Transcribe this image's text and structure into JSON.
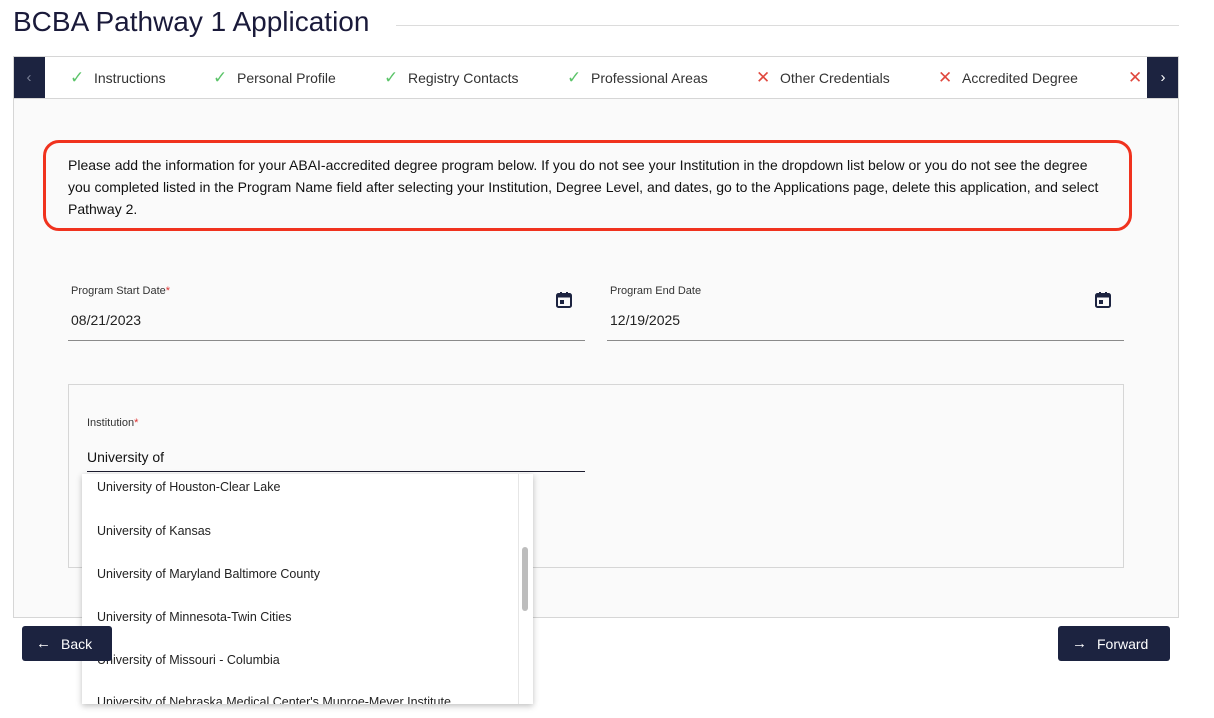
{
  "header": {
    "title": "BCBA Pathway 1 Application"
  },
  "stepper": {
    "prev_icon": "chevron-left-icon",
    "next_icon": "chevron-right-icon",
    "steps": [
      {
        "label": "Instructions",
        "status": "complete"
      },
      {
        "label": "Personal Profile",
        "status": "complete"
      },
      {
        "label": "Registry Contacts",
        "status": "complete"
      },
      {
        "label": "Professional Areas",
        "status": "complete"
      },
      {
        "label": "Other Credentials",
        "status": "incomplete"
      },
      {
        "label": "Accredited Degree",
        "status": "incomplete"
      },
      {
        "label": "",
        "status": "incomplete"
      }
    ],
    "colors": {
      "complete": "#5cc46a",
      "incomplete": "#e0483e"
    }
  },
  "notice": {
    "text": "Please add the information for your ABAI-accredited degree program below. If you do not see your Institution in the dropdown list below or you do not see the degree you completed listed in the Program Name field after selecting your Institution, Degree Level, and dates, go to the Applications page, delete this application, and select Pathway 2.",
    "border_color": "#f0321e"
  },
  "form": {
    "start_date": {
      "label": "Program Start Date",
      "required": "*",
      "value": "08/21/2023",
      "icon": "calendar-icon"
    },
    "end_date": {
      "label": "Program End Date",
      "value": "12/19/2025",
      "icon": "calendar-icon"
    },
    "institution": {
      "label": "Institution",
      "required": "*",
      "value": "University of ",
      "options": [
        "University of Houston-Clear Lake",
        "University of Kansas",
        "University of Maryland Baltimore County",
        "University of Minnesota-Twin Cities",
        "University of Missouri - Columbia",
        "University of Nebraska Medical Center's Munroe-Meyer Institute"
      ]
    }
  },
  "footer": {
    "back_label": "Back",
    "forward_label": "Forward"
  },
  "theme": {
    "primary": "#1c2340"
  }
}
